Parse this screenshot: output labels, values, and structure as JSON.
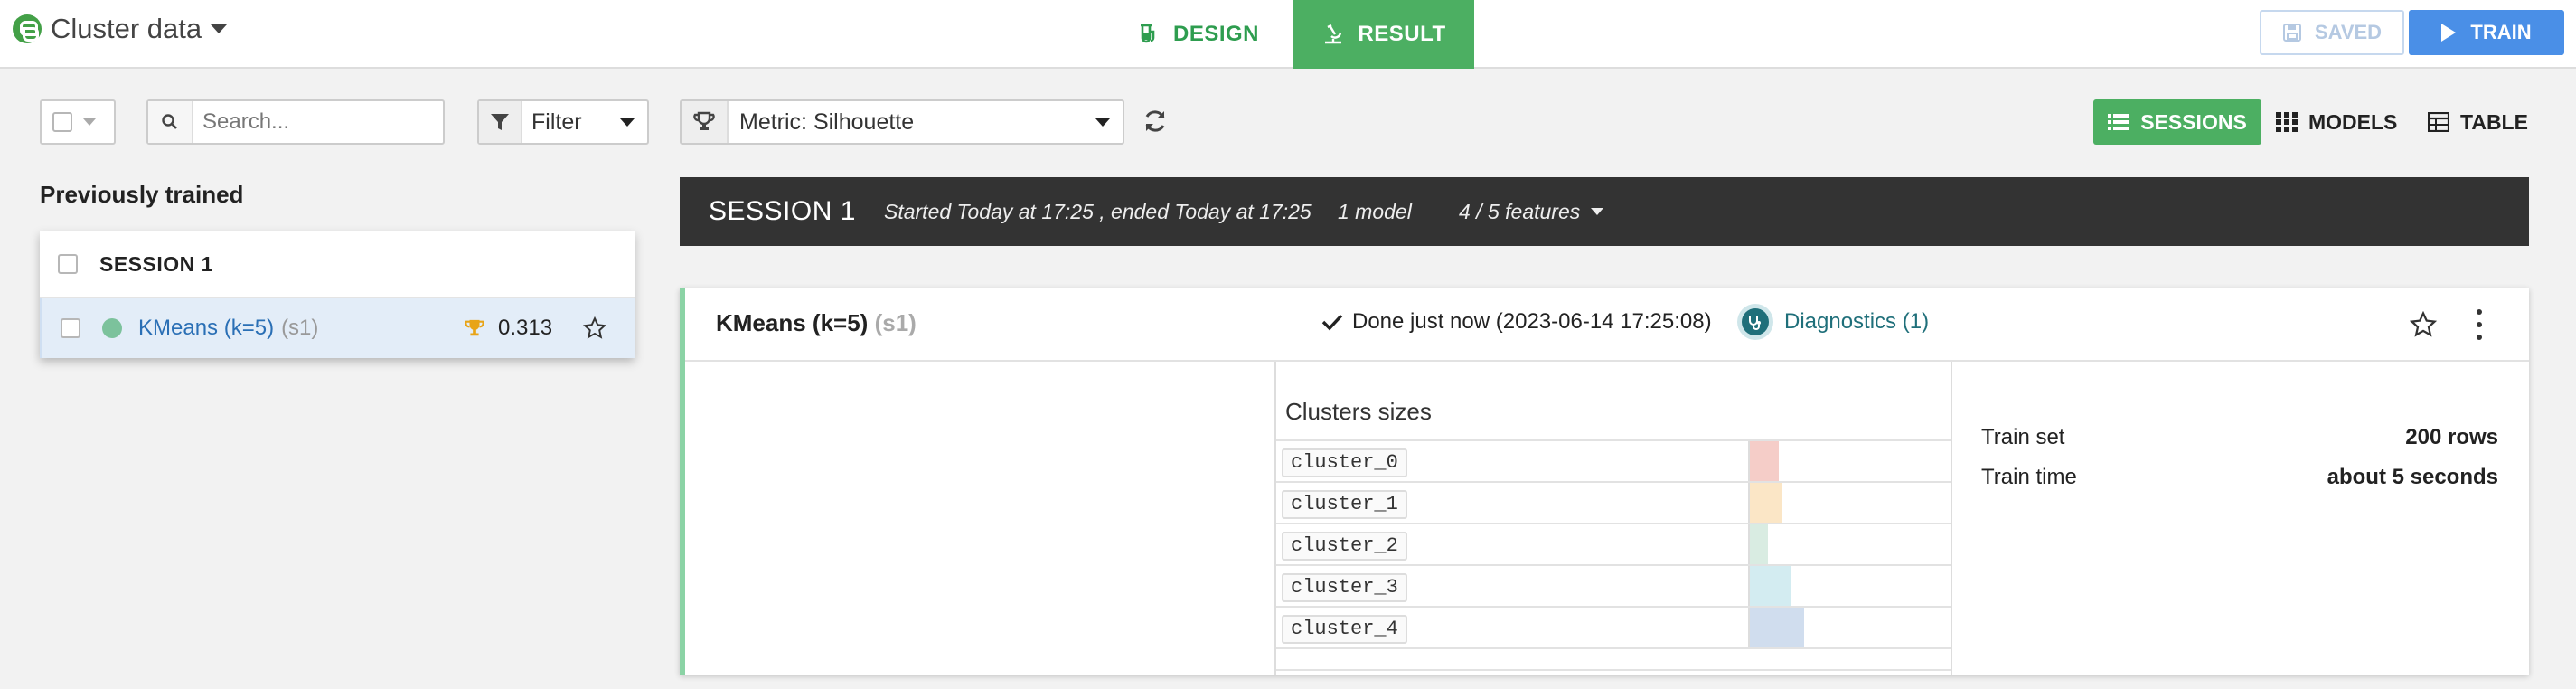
{
  "app": {
    "title": "Cluster data"
  },
  "tabs": {
    "design": "DESIGN",
    "result": "RESULT"
  },
  "actions": {
    "saved": "SAVED",
    "train": "TRAIN"
  },
  "toolbar": {
    "search_placeholder": "Search...",
    "filter_label": "Filter",
    "metric_label": "Metric: Silhouette"
  },
  "views": {
    "sessions": "SESSIONS",
    "models": "MODELS",
    "table": "TABLE"
  },
  "left_panel": {
    "title": "Previously trained",
    "session_label": "SESSION 1",
    "model": {
      "name": "KMeans (k=5)",
      "tag": "(s1)",
      "score": "0.313",
      "dot_color": "#7cc29c"
    }
  },
  "session": {
    "title": "SESSION 1",
    "time": "Started Today at 17:25 , ended Today at 17:25",
    "models": "1 model",
    "features": "4 / 5 features"
  },
  "card": {
    "model_name": "KMeans (k=5)",
    "model_tag": "(s1)",
    "status": "Done just now (2023-06-14 17:25:08)",
    "diagnostics": "Diagnostics (1)",
    "clusters_title": "Clusters sizes",
    "clusters": [
      {
        "name": "cluster_0",
        "size": 0.53,
        "color": "#f5cdc8"
      },
      {
        "name": "cluster_1",
        "size": 0.6,
        "color": "#fbe6c6"
      },
      {
        "name": "cluster_2",
        "size": 0.33,
        "color": "#d9ece2"
      },
      {
        "name": "cluster_3",
        "size": 0.76,
        "color": "#d3ecf1"
      },
      {
        "name": "cluster_4",
        "size": 1.0,
        "color": "#d0ddee"
      }
    ],
    "train_set_label": "Train set",
    "train_set_value": "200 rows",
    "train_time_label": "Train time",
    "train_time_value": "about 5 seconds"
  },
  "colors": {
    "accent_green": "#4caf62",
    "train_blue": "#4a8fe7",
    "session_bar": "#333333"
  }
}
